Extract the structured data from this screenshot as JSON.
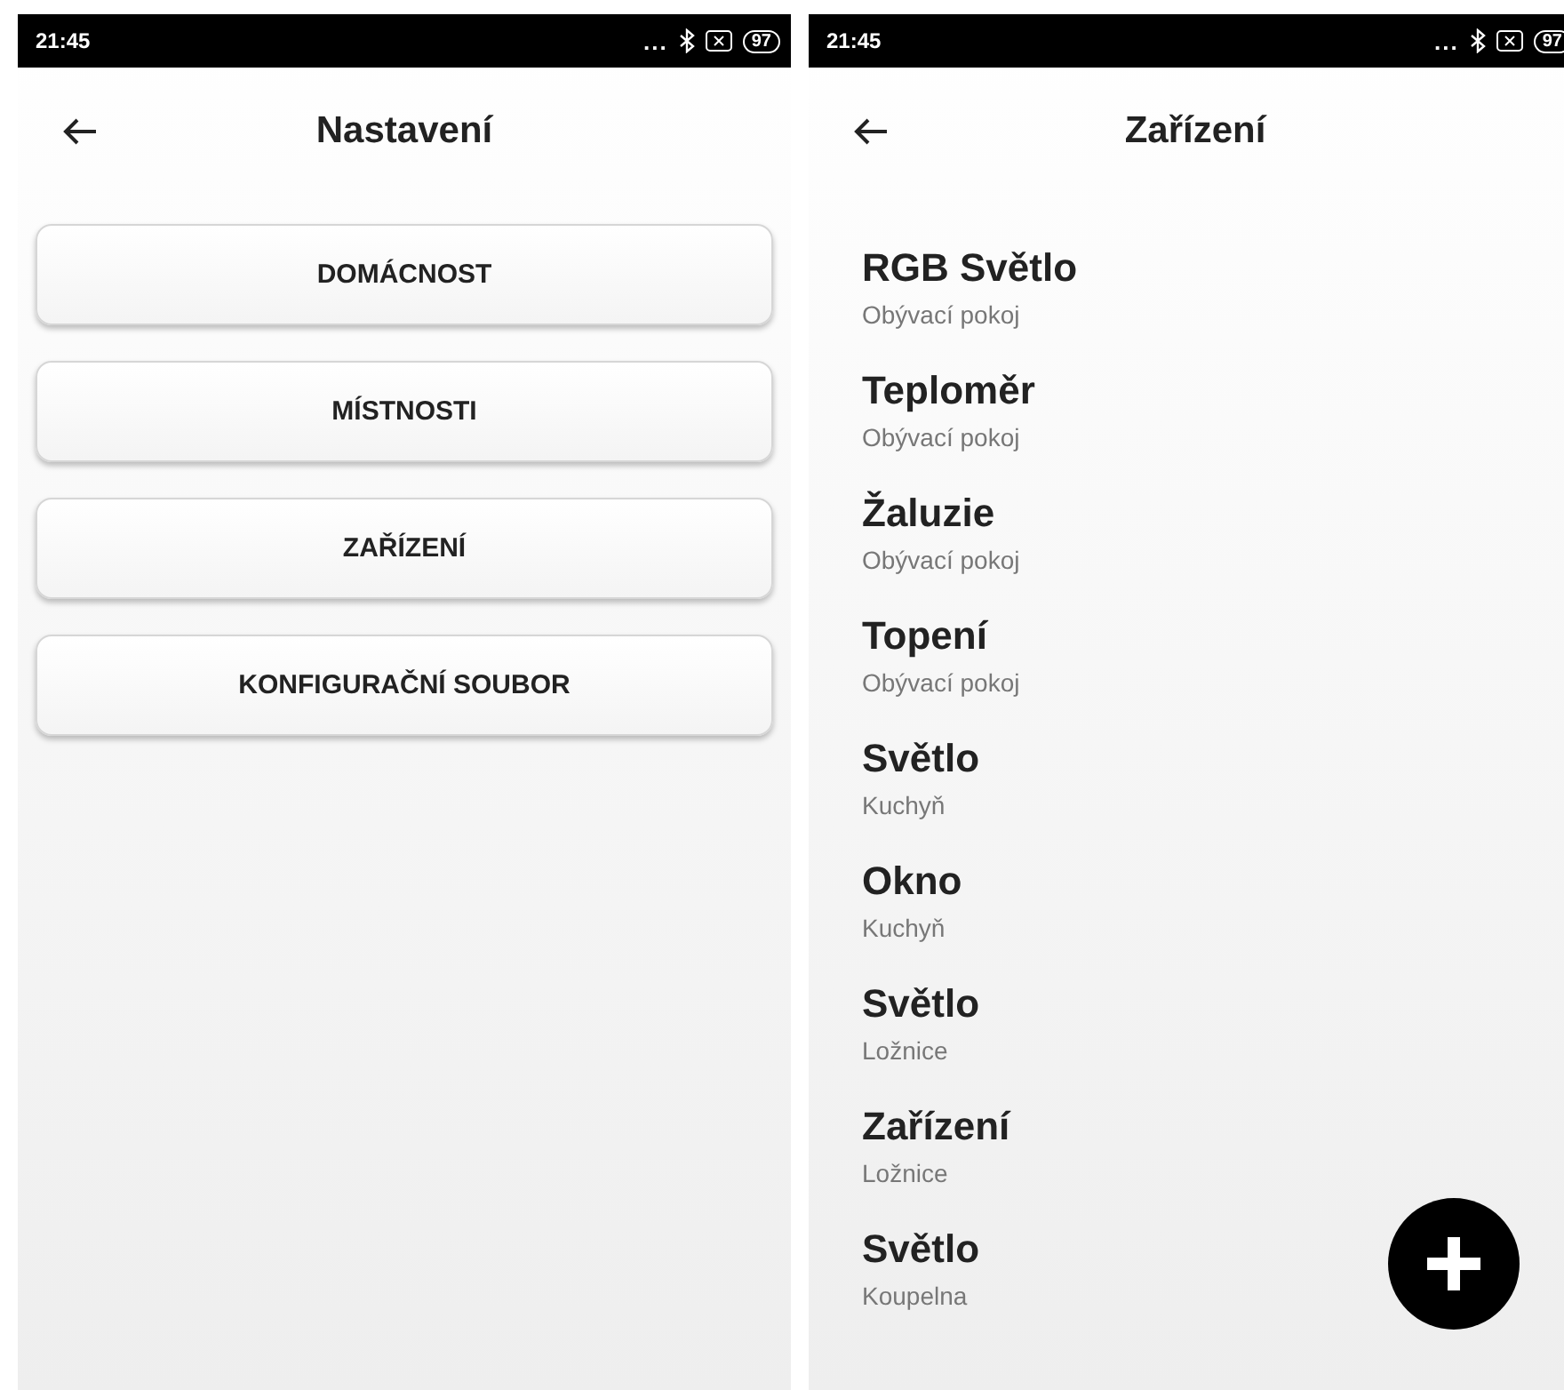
{
  "screens": [
    {
      "status_bar": {
        "time": "21:45",
        "dots": "...",
        "battery": "97"
      },
      "title": "Nastavení",
      "buttons": [
        "DOMÁCNOST",
        "MÍSTNOSTI",
        "ZAŘÍZENÍ",
        "KONFIGURAČNÍ SOUBOR"
      ]
    },
    {
      "status_bar": {
        "time": "21:45",
        "dots": "...",
        "battery": "97"
      },
      "title": "Zařízení",
      "devices": [
        {
          "name": "RGB Světlo",
          "room": "Obývací pokoj"
        },
        {
          "name": "Teploměr",
          "room": "Obývací pokoj"
        },
        {
          "name": "Žaluzie",
          "room": "Obývací pokoj"
        },
        {
          "name": "Topení",
          "room": "Obývací pokoj"
        },
        {
          "name": "Světlo",
          "room": "Kuchyň"
        },
        {
          "name": "Okno",
          "room": "Kuchyň"
        },
        {
          "name": "Světlo",
          "room": "Ložnice"
        },
        {
          "name": "Zařízení",
          "room": "Ložnice"
        },
        {
          "name": "Světlo",
          "room": "Koupelna"
        }
      ],
      "fab": true
    }
  ]
}
